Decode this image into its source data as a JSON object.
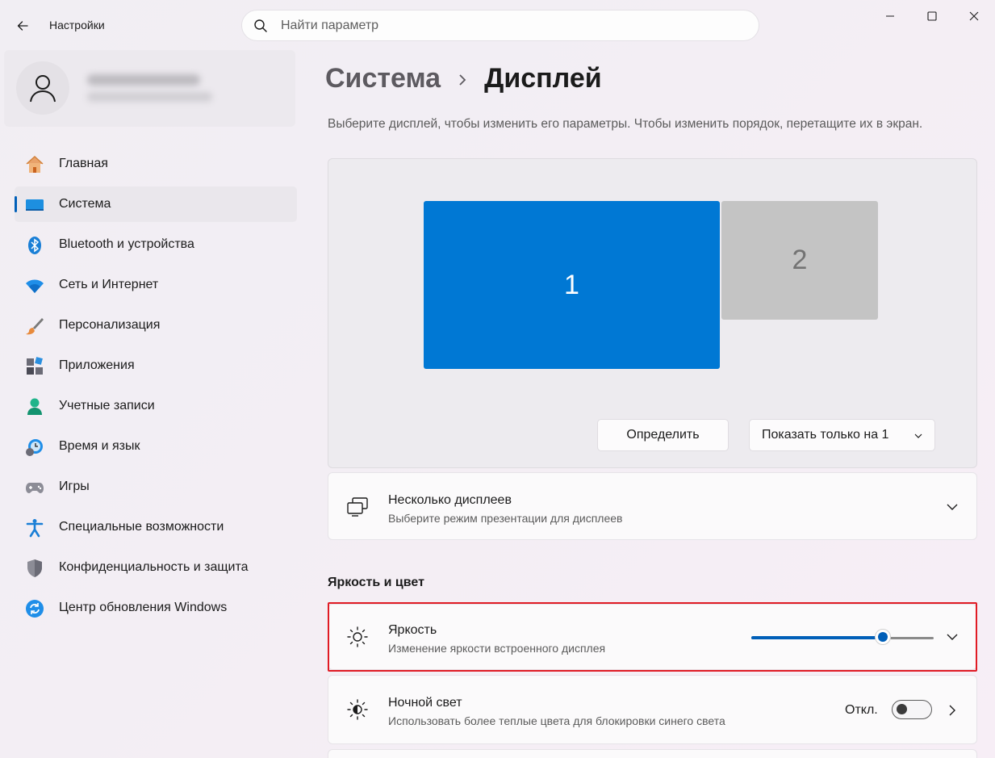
{
  "window": {
    "title": "Настройки",
    "controls": [
      "minimize",
      "maximize",
      "close"
    ]
  },
  "search": {
    "placeholder": "Найти параметр"
  },
  "sidebar": {
    "items": [
      {
        "label": "Главная",
        "icon": "home-icon"
      },
      {
        "label": "Система",
        "icon": "system-icon",
        "active": true
      },
      {
        "label": "Bluetooth и устройства",
        "icon": "bluetooth-icon"
      },
      {
        "label": "Сеть и Интернет",
        "icon": "wifi-icon"
      },
      {
        "label": "Персонализация",
        "icon": "brush-icon"
      },
      {
        "label": "Приложения",
        "icon": "apps-icon"
      },
      {
        "label": "Учетные записи",
        "icon": "account-icon"
      },
      {
        "label": "Время и язык",
        "icon": "time-language-icon"
      },
      {
        "label": "Игры",
        "icon": "gamepad-icon"
      },
      {
        "label": "Специальные возможности",
        "icon": "accessibility-icon"
      },
      {
        "label": "Конфиденциальность и защита",
        "icon": "shield-icon"
      },
      {
        "label": "Центр обновления Windows",
        "icon": "update-icon"
      }
    ]
  },
  "main": {
    "breadcrumb": {
      "parent": "Система",
      "separator": "›",
      "current": "Дисплей"
    },
    "description": "Выберите дисплей, чтобы изменить его параметры. Чтобы изменить порядок, перетащите их в экран.",
    "displays": [
      {
        "label": "1",
        "selected": true
      },
      {
        "label": "2",
        "selected": false
      }
    ],
    "identify_button": "Определить",
    "show_only_select": "Показать только на 1",
    "multiple_displays": {
      "title": "Несколько дисплеев",
      "subtitle": "Выберите режим презентации для дисплеев"
    },
    "brightness_section": "Яркость и цвет",
    "brightness": {
      "title": "Яркость",
      "subtitle": "Изменение яркости встроенного дисплея",
      "value_percent": 72
    },
    "night_light": {
      "title": "Ночной свет",
      "subtitle": "Использовать более теплые цвета для блокировки синего света",
      "state_label": "Откл.",
      "on": false
    }
  },
  "colors": {
    "accent": "#005fb8",
    "display_selected": "#0078d4",
    "display_other": "#c4c4c4",
    "highlight_border": "#e01b24"
  }
}
